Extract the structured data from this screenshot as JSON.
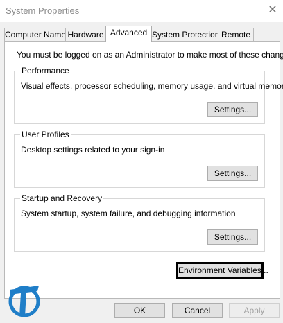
{
  "window": {
    "title": "System Properties"
  },
  "tabs": [
    {
      "label": "Computer Name"
    },
    {
      "label": "Hardware"
    },
    {
      "label": "Advanced"
    },
    {
      "label": "System Protection"
    },
    {
      "label": "Remote"
    }
  ],
  "active_tab": "Advanced",
  "notice": "You must be logged on as an Administrator to make most of these changes.",
  "groups": {
    "performance": {
      "title": "Performance",
      "description": "Visual effects, processor scheduling, memory usage, and virtual memory",
      "button": "Settings..."
    },
    "user_profiles": {
      "title": "User Profiles",
      "description": "Desktop settings related to your sign-in",
      "button": "Settings..."
    },
    "startup": {
      "title": "Startup and Recovery",
      "description": "System startup, system failure, and debugging information",
      "button": "Settings..."
    }
  },
  "env_button": "Environment Variables...",
  "footer": {
    "ok": "OK",
    "cancel": "Cancel",
    "apply": "Apply"
  },
  "colors": {
    "logo": "#1f7ec8",
    "title_text": "#8a8a8a",
    "disabled_text": "#a0a0a0"
  },
  "icons": {
    "close": "close-icon",
    "logo": "watermark-logo-icon"
  }
}
